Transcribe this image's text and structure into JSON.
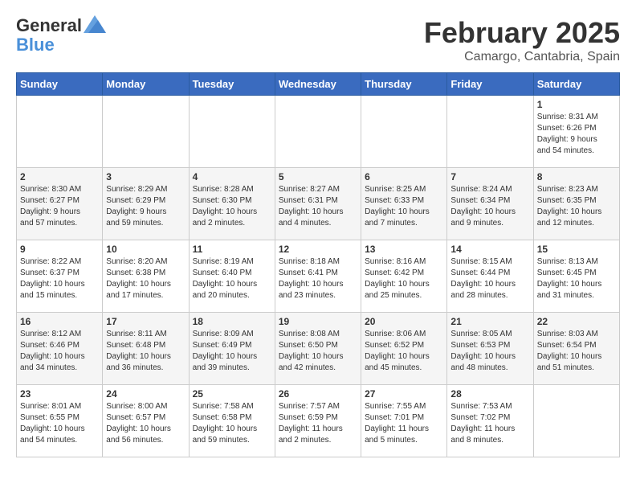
{
  "logo": {
    "line1": "General",
    "line2": "Blue"
  },
  "title": "February 2025",
  "location": "Camargo, Cantabria, Spain",
  "weekdays": [
    "Sunday",
    "Monday",
    "Tuesday",
    "Wednesday",
    "Thursday",
    "Friday",
    "Saturday"
  ],
  "weeks": [
    [
      {
        "day": "",
        "info": ""
      },
      {
        "day": "",
        "info": ""
      },
      {
        "day": "",
        "info": ""
      },
      {
        "day": "",
        "info": ""
      },
      {
        "day": "",
        "info": ""
      },
      {
        "day": "",
        "info": ""
      },
      {
        "day": "1",
        "info": "Sunrise: 8:31 AM\nSunset: 6:26 PM\nDaylight: 9 hours\nand 54 minutes."
      }
    ],
    [
      {
        "day": "2",
        "info": "Sunrise: 8:30 AM\nSunset: 6:27 PM\nDaylight: 9 hours\nand 57 minutes."
      },
      {
        "day": "3",
        "info": "Sunrise: 8:29 AM\nSunset: 6:29 PM\nDaylight: 9 hours\nand 59 minutes."
      },
      {
        "day": "4",
        "info": "Sunrise: 8:28 AM\nSunset: 6:30 PM\nDaylight: 10 hours\nand 2 minutes."
      },
      {
        "day": "5",
        "info": "Sunrise: 8:27 AM\nSunset: 6:31 PM\nDaylight: 10 hours\nand 4 minutes."
      },
      {
        "day": "6",
        "info": "Sunrise: 8:25 AM\nSunset: 6:33 PM\nDaylight: 10 hours\nand 7 minutes."
      },
      {
        "day": "7",
        "info": "Sunrise: 8:24 AM\nSunset: 6:34 PM\nDaylight: 10 hours\nand 9 minutes."
      },
      {
        "day": "8",
        "info": "Sunrise: 8:23 AM\nSunset: 6:35 PM\nDaylight: 10 hours\nand 12 minutes."
      }
    ],
    [
      {
        "day": "9",
        "info": "Sunrise: 8:22 AM\nSunset: 6:37 PM\nDaylight: 10 hours\nand 15 minutes."
      },
      {
        "day": "10",
        "info": "Sunrise: 8:20 AM\nSunset: 6:38 PM\nDaylight: 10 hours\nand 17 minutes."
      },
      {
        "day": "11",
        "info": "Sunrise: 8:19 AM\nSunset: 6:40 PM\nDaylight: 10 hours\nand 20 minutes."
      },
      {
        "day": "12",
        "info": "Sunrise: 8:18 AM\nSunset: 6:41 PM\nDaylight: 10 hours\nand 23 minutes."
      },
      {
        "day": "13",
        "info": "Sunrise: 8:16 AM\nSunset: 6:42 PM\nDaylight: 10 hours\nand 25 minutes."
      },
      {
        "day": "14",
        "info": "Sunrise: 8:15 AM\nSunset: 6:44 PM\nDaylight: 10 hours\nand 28 minutes."
      },
      {
        "day": "15",
        "info": "Sunrise: 8:13 AM\nSunset: 6:45 PM\nDaylight: 10 hours\nand 31 minutes."
      }
    ],
    [
      {
        "day": "16",
        "info": "Sunrise: 8:12 AM\nSunset: 6:46 PM\nDaylight: 10 hours\nand 34 minutes."
      },
      {
        "day": "17",
        "info": "Sunrise: 8:11 AM\nSunset: 6:48 PM\nDaylight: 10 hours\nand 36 minutes."
      },
      {
        "day": "18",
        "info": "Sunrise: 8:09 AM\nSunset: 6:49 PM\nDaylight: 10 hours\nand 39 minutes."
      },
      {
        "day": "19",
        "info": "Sunrise: 8:08 AM\nSunset: 6:50 PM\nDaylight: 10 hours\nand 42 minutes."
      },
      {
        "day": "20",
        "info": "Sunrise: 8:06 AM\nSunset: 6:52 PM\nDaylight: 10 hours\nand 45 minutes."
      },
      {
        "day": "21",
        "info": "Sunrise: 8:05 AM\nSunset: 6:53 PM\nDaylight: 10 hours\nand 48 minutes."
      },
      {
        "day": "22",
        "info": "Sunrise: 8:03 AM\nSunset: 6:54 PM\nDaylight: 10 hours\nand 51 minutes."
      }
    ],
    [
      {
        "day": "23",
        "info": "Sunrise: 8:01 AM\nSunset: 6:55 PM\nDaylight: 10 hours\nand 54 minutes."
      },
      {
        "day": "24",
        "info": "Sunrise: 8:00 AM\nSunset: 6:57 PM\nDaylight: 10 hours\nand 56 minutes."
      },
      {
        "day": "25",
        "info": "Sunrise: 7:58 AM\nSunset: 6:58 PM\nDaylight: 10 hours\nand 59 minutes."
      },
      {
        "day": "26",
        "info": "Sunrise: 7:57 AM\nSunset: 6:59 PM\nDaylight: 11 hours\nand 2 minutes."
      },
      {
        "day": "27",
        "info": "Sunrise: 7:55 AM\nSunset: 7:01 PM\nDaylight: 11 hours\nand 5 minutes."
      },
      {
        "day": "28",
        "info": "Sunrise: 7:53 AM\nSunset: 7:02 PM\nDaylight: 11 hours\nand 8 minutes."
      },
      {
        "day": "",
        "info": ""
      }
    ]
  ]
}
